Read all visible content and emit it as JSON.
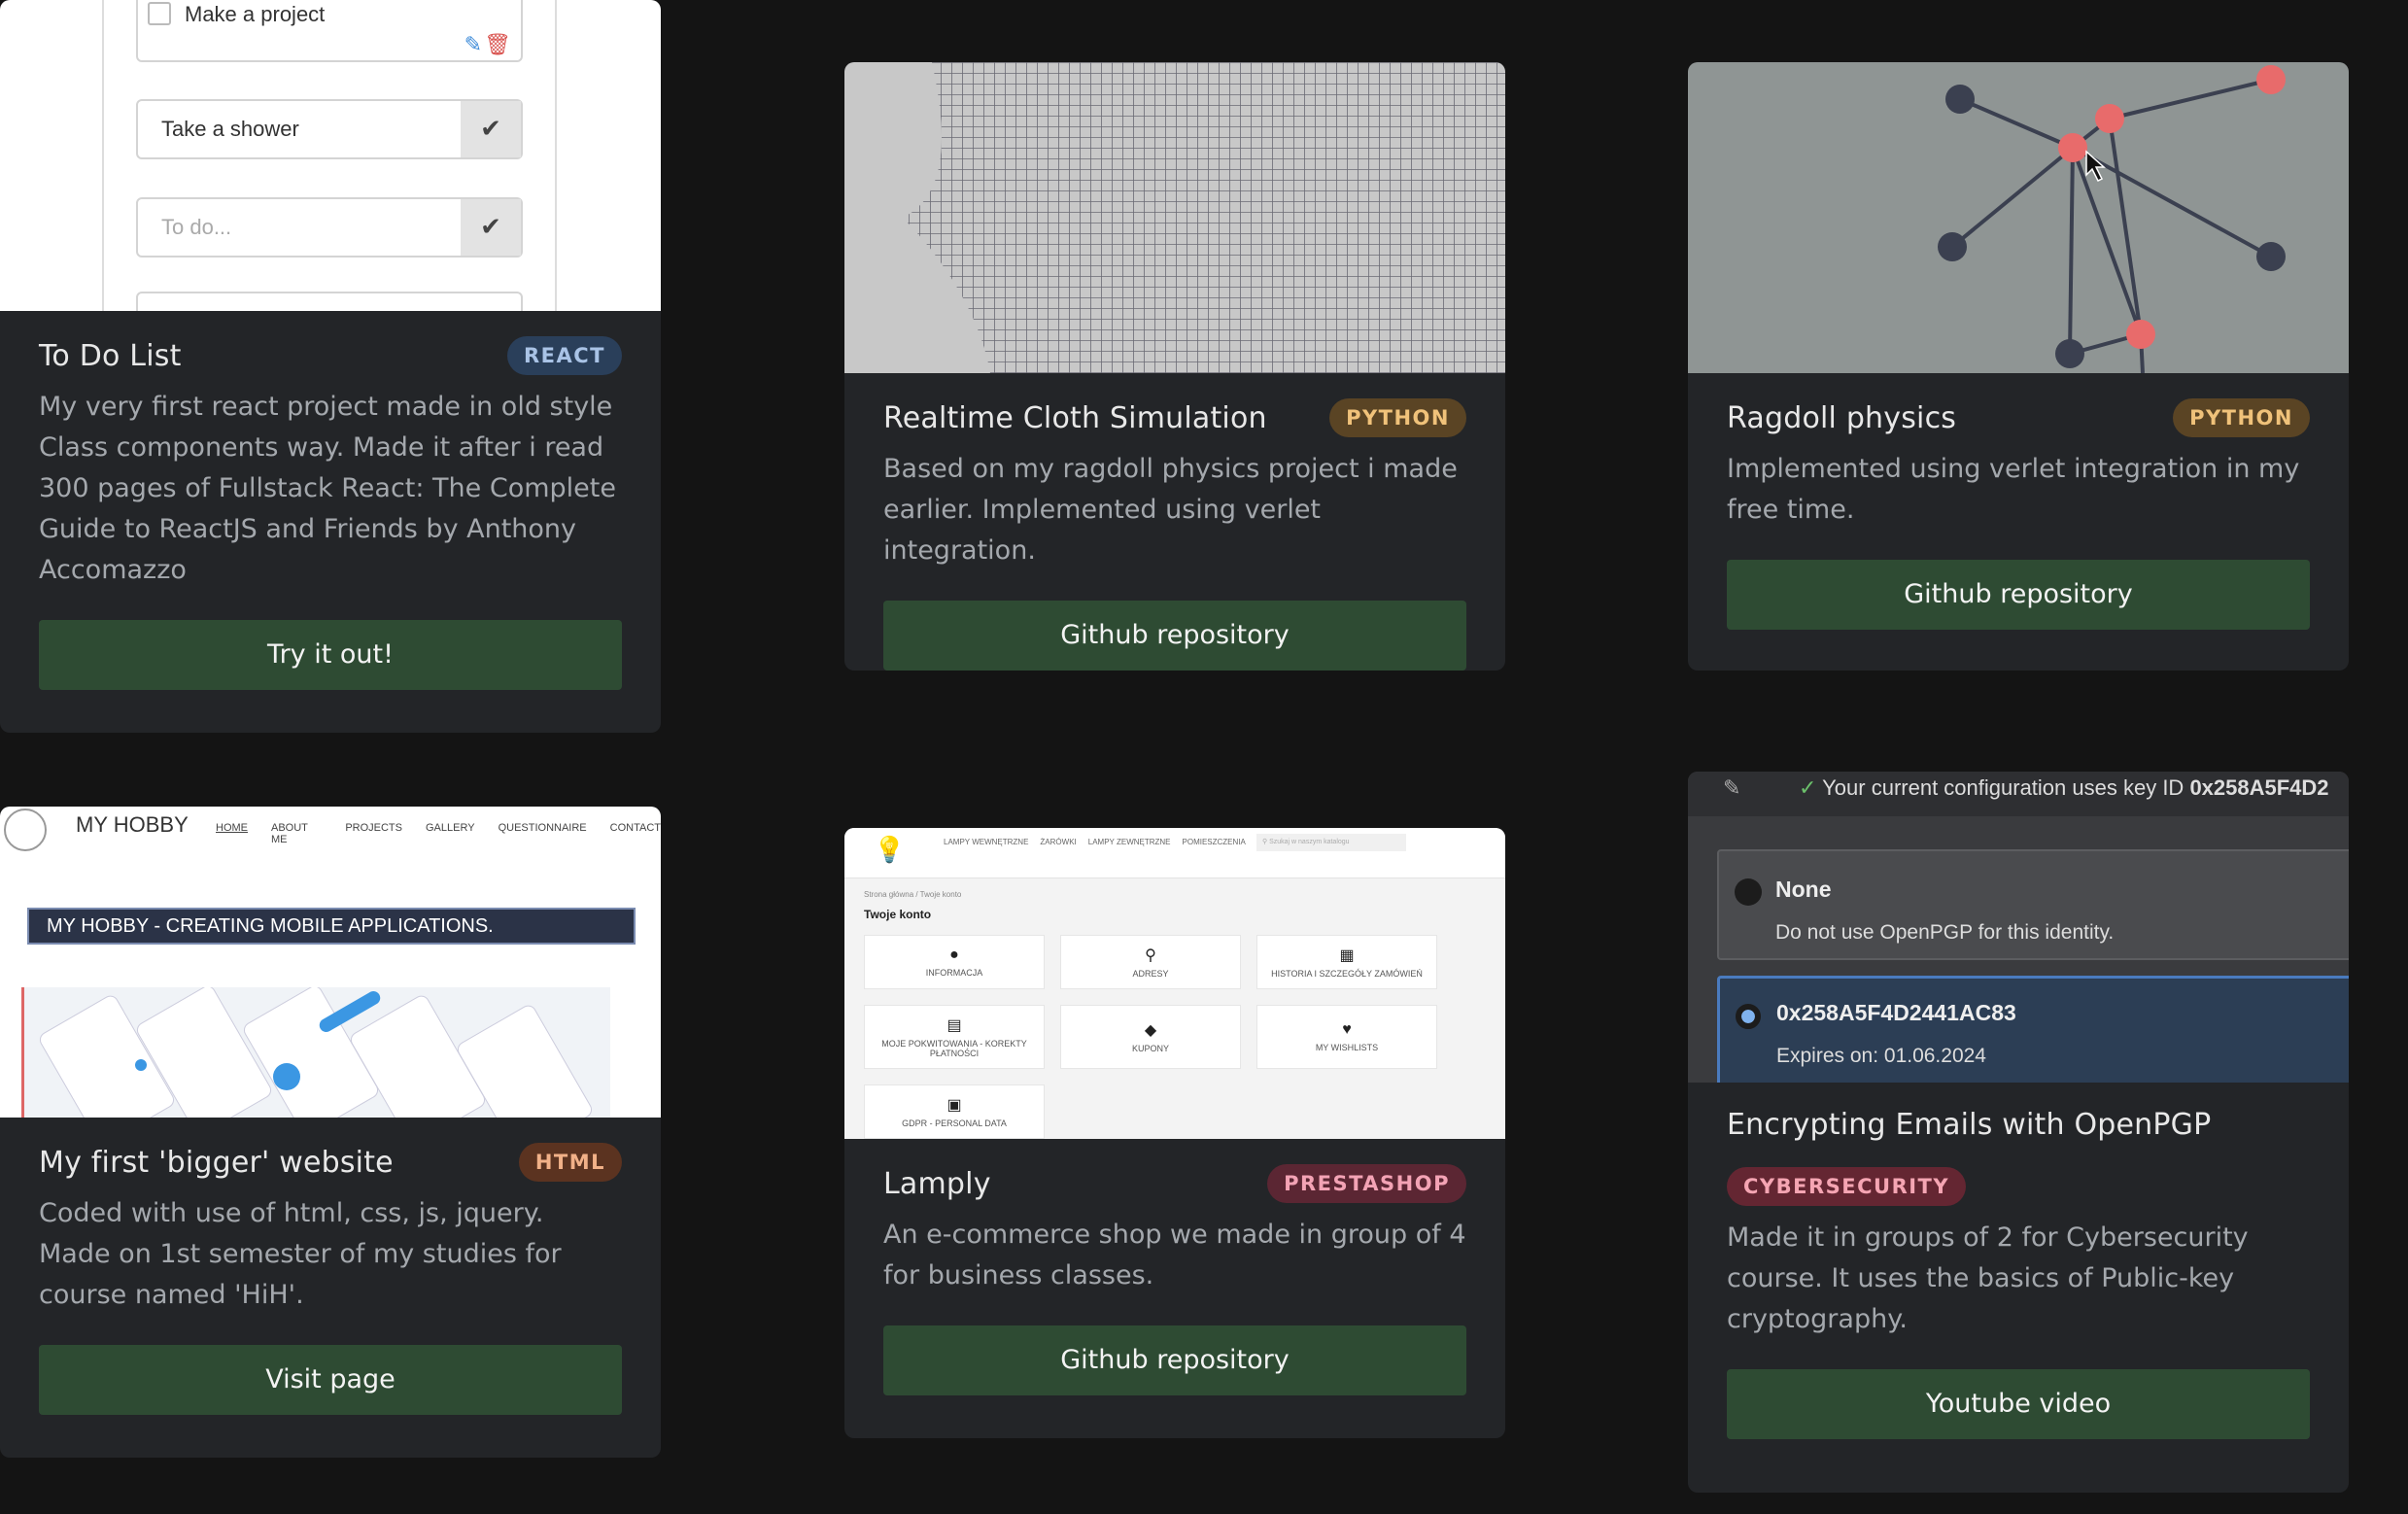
{
  "cards": [
    {
      "title": "To Do List",
      "badge": "REACT",
      "description": "My very first react project made in old style Class components way. Made it after i read 300 pages of Fullstack React: The Complete Guide to ReactJS and Friends by Anthony Accomazzo",
      "button": "Try it out!",
      "thumb": {
        "item_top": "Make a project",
        "item_shower": "Take a shower",
        "placeholder": "To do..."
      }
    },
    {
      "title": "Realtime Cloth Simulation",
      "badge": "PYTHON",
      "description": "Based on my ragdoll physics project i made earlier. Implemented using verlet integration.",
      "button": "Github repository"
    },
    {
      "title": "Ragdoll physics",
      "badge": "PYTHON",
      "description": "Implemented using verlet integration in my free time.",
      "button": "Github repository"
    },
    {
      "title": "My first 'bigger' website",
      "badge": "HTML",
      "description": "Coded with use of html, css, js, jquery. Made on 1st semester of my studies for course named 'HiH'.",
      "button": "Visit page",
      "thumb": {
        "logo": "MY HOBBY",
        "nav": [
          "HOME",
          "ABOUT ME",
          "PROJECTS",
          "GALLERY",
          "QUESTIONNAIRE",
          "CONTACT"
        ],
        "banner": "MY HOBBY - CREATING MOBILE APPLICATIONS."
      }
    },
    {
      "title": "Lamply",
      "badge": "PRESTASHOP",
      "description": "An e-commerce shop we made in group of 4 for business classes.",
      "button": "Github repository",
      "thumb": {
        "nav": [
          "LAMPY WEWNĘTRZNE",
          "ŻARÓWKI",
          "LAMPY ZEWNĘTRZNE",
          "POMIESZCZENIA"
        ],
        "search_placeholder": "Szukaj w naszym katalogu",
        "breadcrumb": "Strona główna  /  Twoje konto",
        "heading": "Twoje konto",
        "tiles": [
          "INFORMACJA",
          "ADRESY",
          "HISTORIA I SZCZEGÓŁY ZAMÓWIEŃ",
          "MOJE POKWITOWANIA - KOREKTY PŁATNOŚCI",
          "KUPONY",
          "MY WISHLISTS",
          "GDPR - PERSONAL DATA"
        ]
      }
    },
    {
      "title": "Encrypting Emails with OpenPGP",
      "badge": "CYBERSECURITY",
      "description": "Made it in groups of 2 for Cybersecurity course. It uses the basics of Public-key cryptography.",
      "button": "Youtube video",
      "thumb": {
        "config": "Your current configuration uses key ID ",
        "config_key": "0x258A5F4D2",
        "opt1_title": "None",
        "opt1_desc": "Do not use OpenPGP for this identity.",
        "opt2_title": "0x258A5F4D2441AC83",
        "opt2_desc": "Expires on: 01.06.2024"
      }
    }
  ],
  "colors": {
    "page_bg": "#141414",
    "card_bg": "#232528",
    "button_bg": "#2e4b33"
  }
}
